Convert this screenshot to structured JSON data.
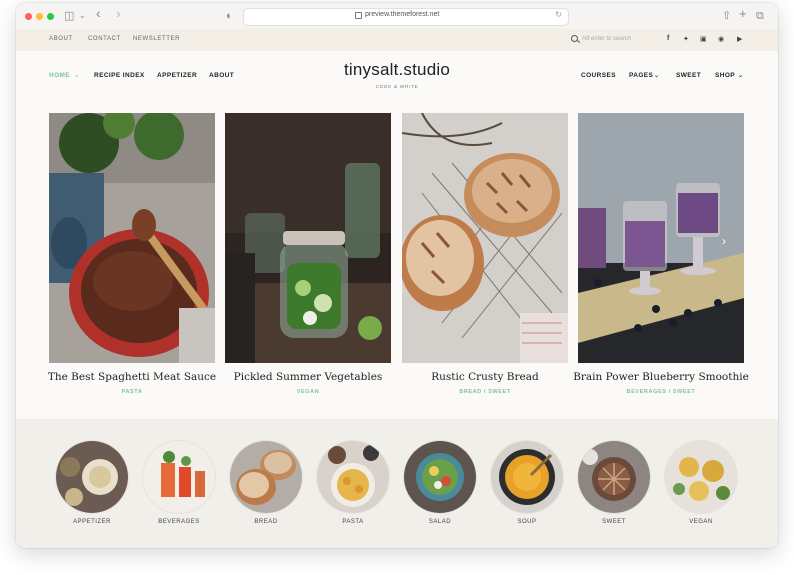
{
  "browser": {
    "url": "preview.themeforest.net"
  },
  "topbar": {
    "links": [
      "ABOUT",
      "CONTACT",
      "NEWSLETTER"
    ],
    "search_placeholder": "Hit enter to search",
    "social": [
      "f",
      "t",
      "ig",
      "p",
      "yt"
    ]
  },
  "nav": {
    "left": [
      "HOME",
      "RECIPE INDEX",
      "APPETIZER",
      "ABOUT"
    ],
    "right": [
      "COURSES",
      "PAGES",
      "SWEET",
      "SHOP"
    ],
    "logo": "tinysalt.studio",
    "tagline": "COOK & WRITE"
  },
  "slider": {
    "cards": [
      {
        "title": "The Best Spaghetti Meat Sauce",
        "category": "PASTA"
      },
      {
        "title": "Pickled Summer Vegetables",
        "category": "VEGAN"
      },
      {
        "title": "Rustic Crusty Bread",
        "category": "BREAD / SWEET"
      },
      {
        "title": "Brain Power Blueberry Smoothie",
        "category": "BEVERAGES / SWEET"
      }
    ]
  },
  "categories": [
    "APPETIZER",
    "BEVERAGES",
    "BREAD",
    "PASTA",
    "SALAD",
    "SOUP",
    "SWEET",
    "VEGAN"
  ],
  "colors": {
    "accent": "#7ec49b",
    "topbar_bg": "#f3efe6",
    "category_bg": "#f1efe9"
  }
}
